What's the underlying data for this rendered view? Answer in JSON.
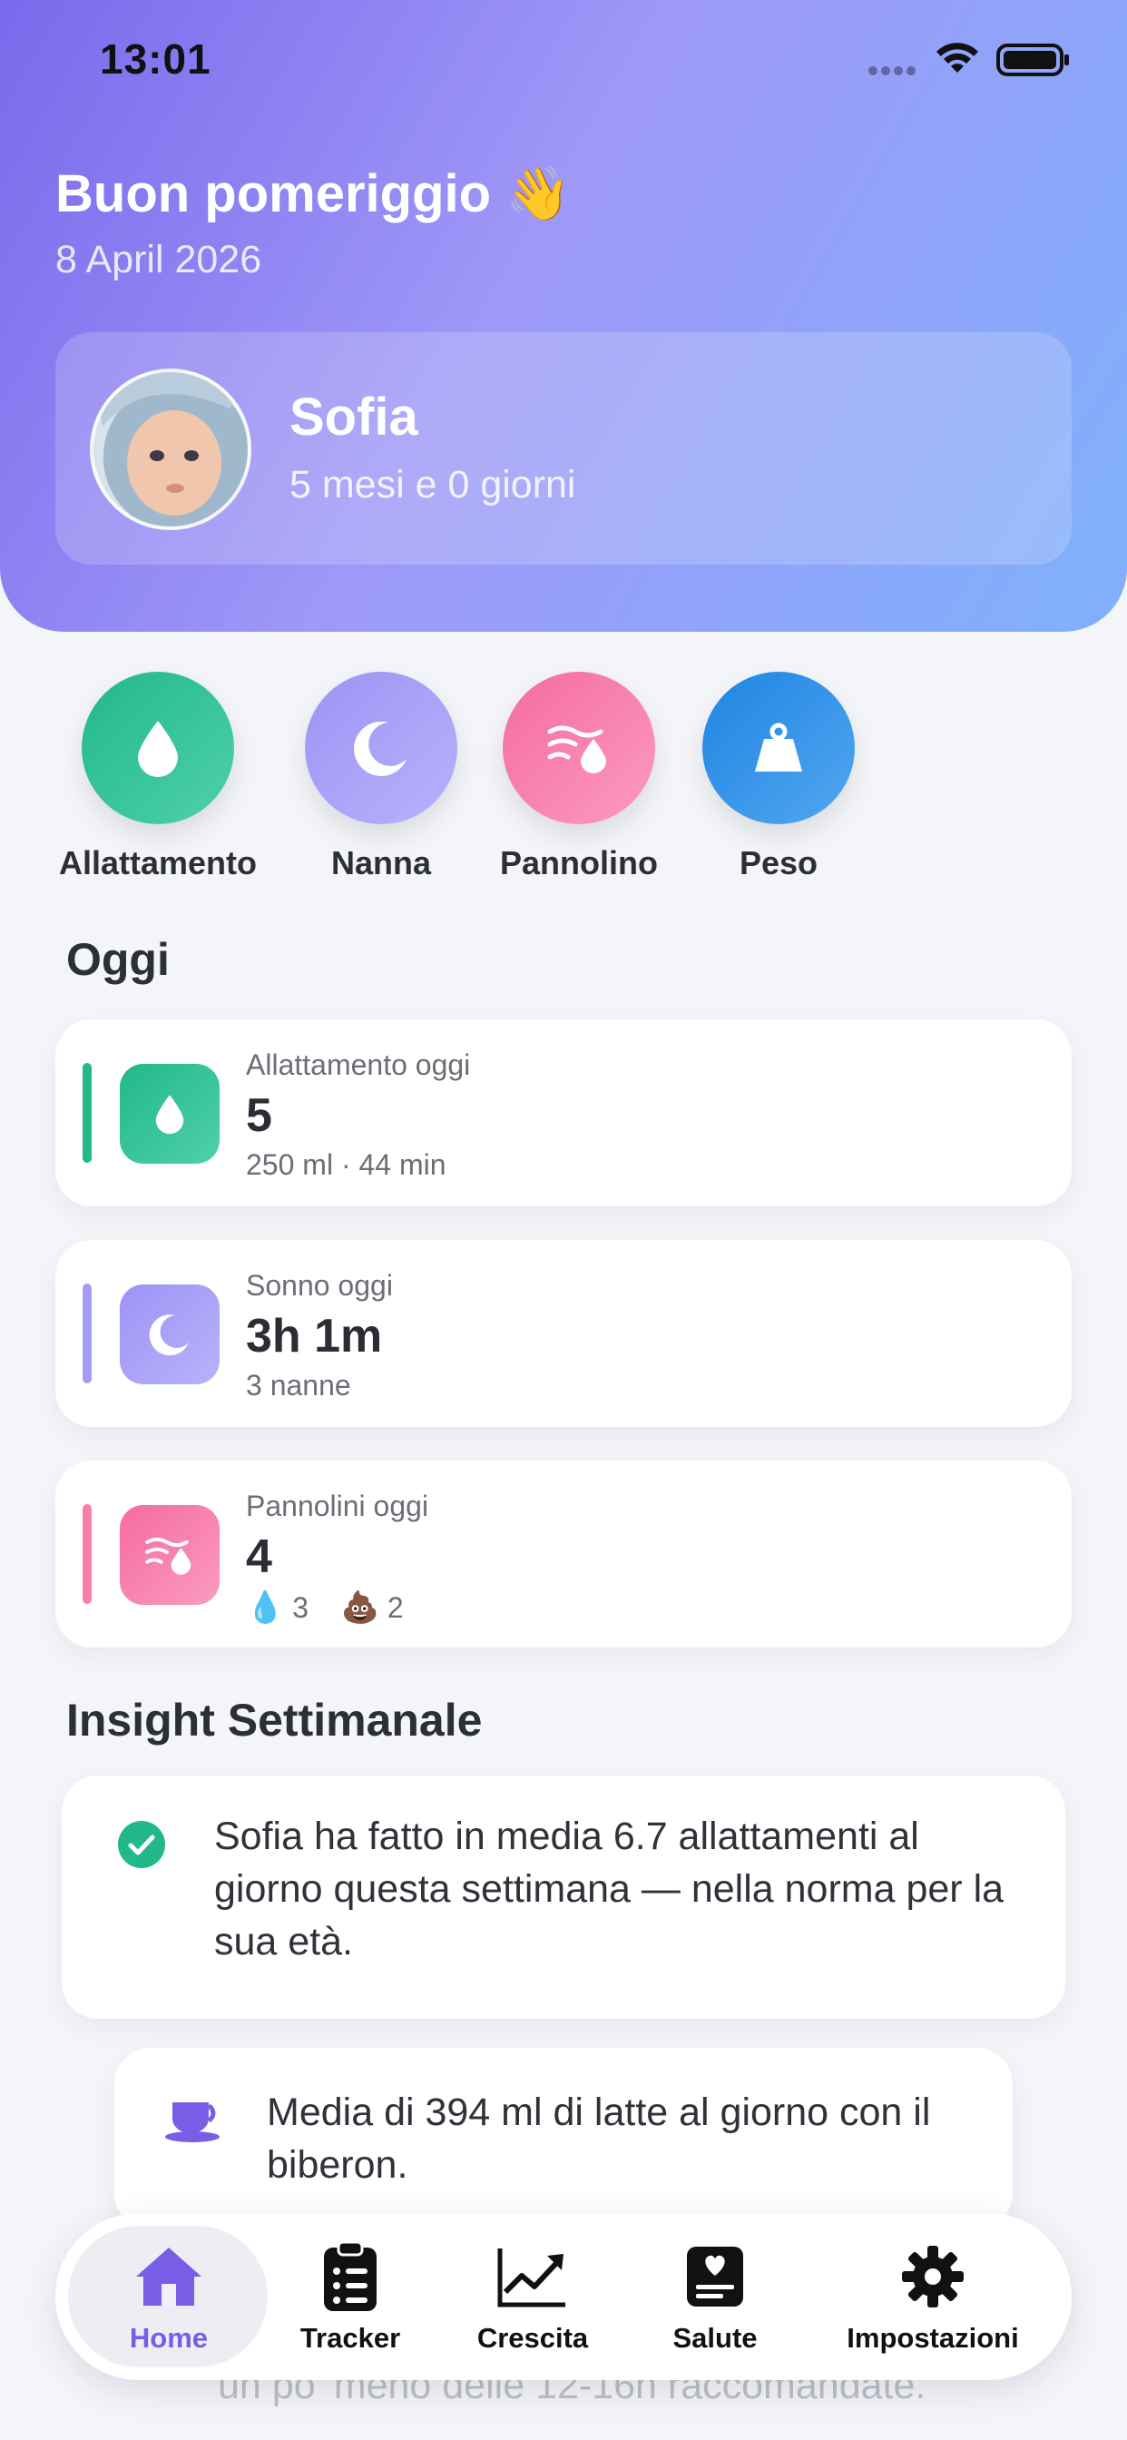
{
  "status_bar": {
    "time": "13:01"
  },
  "header": {
    "greeting": "Buon pomeriggio 👋",
    "date": "8 April 2026"
  },
  "profile": {
    "name": "Sofia",
    "age": "5 mesi e 0 giorni"
  },
  "quick_actions": [
    {
      "label": "Allattamento",
      "icon": "drop-icon",
      "color": "#2bbf97"
    },
    {
      "label": "Nanna",
      "icon": "moon-icon",
      "color": "#a59cf8"
    },
    {
      "label": "Pannolino",
      "icon": "diaper-icon",
      "color": "#f77fab"
    },
    {
      "label": "Peso",
      "icon": "weight-icon",
      "color": "#2f8fe6"
    }
  ],
  "today": {
    "title": "Oggi",
    "cards": [
      {
        "label": "Allattamento oggi",
        "value": "5",
        "sub": "250 ml · 44 min",
        "accent": "#22b889"
      },
      {
        "label": "Sonno oggi",
        "value": "3h 1m",
        "sub": "3 nanne",
        "accent": "#a49cf7"
      },
      {
        "label": "Pannolini oggi",
        "value": "4",
        "wet_icon": "💧",
        "wet_count": "3",
        "dirty_icon": "💩",
        "dirty_count": "2",
        "accent": "#f77fab"
      }
    ]
  },
  "insights": {
    "title": "Insight Settimanale",
    "items": [
      {
        "icon": "check-circle-icon",
        "text": "Sofia ha fatto in media 6.7 allattamenti al giorno questa settimana — nella norma per la sua età."
      },
      {
        "icon": "cup-icon",
        "text": "Media di 394 ml di latte al giorno con il biberon."
      },
      {
        "icon": "",
        "text": "un po' meno delle 12-16h raccomandate."
      }
    ]
  },
  "tabbar": {
    "tabs": [
      {
        "label": "Home",
        "icon": "house-icon",
        "active": true
      },
      {
        "label": "Tracker",
        "icon": "clipboard-icon"
      },
      {
        "label": "Crescita",
        "icon": "chart-icon"
      },
      {
        "label": "Salute",
        "icon": "health-icon"
      },
      {
        "label": "Impostazioni",
        "icon": "gear-icon"
      }
    ],
    "active_color": "#7a5de6"
  }
}
